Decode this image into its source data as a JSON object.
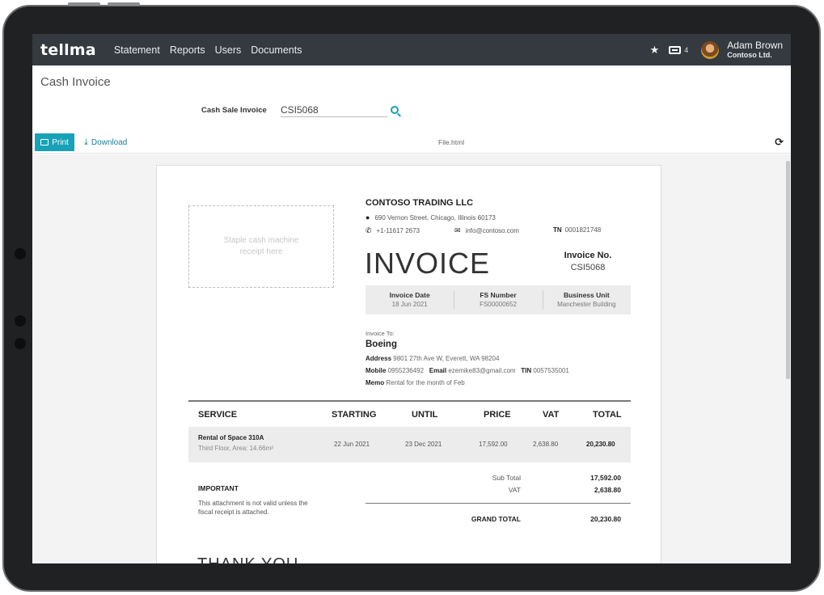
{
  "app": {
    "logo": "tellma",
    "nav": [
      "Statement",
      "Reports",
      "Users",
      "Documents"
    ],
    "inbox_count": "4",
    "user_name": "Adam Brown",
    "user_org": "Contoso Ltd."
  },
  "page": {
    "title": "Cash Invoice",
    "field_label": "Cash Sale Invoice",
    "field_value": "CSI5068"
  },
  "toolbar": {
    "print_label": "Print",
    "download_label": "Download",
    "file_name": "File.html"
  },
  "invoice": {
    "staple_note": "Staple cash machine receipt here",
    "company": "CONTOSO TRADING LLC",
    "address": "690 Vernon Street, Chicago, Illinois 60173",
    "phone": "+1-11617 2673",
    "email": "info@contoso.com",
    "tn_label": "TN",
    "tn_value": "0001821748",
    "title": "INVOICE",
    "invoice_no_label": "Invoice No.",
    "invoice_no_value": "CSI5068",
    "info": [
      {
        "label": "Invoice Date",
        "value": "18 Jun 2021"
      },
      {
        "label": "FS Number",
        "value": "FS00000652"
      },
      {
        "label": "Business Unit",
        "value": "Manchester Building"
      }
    ],
    "invoice_to_label": "Invoice To:",
    "client": "Boeing",
    "address_label": "Address",
    "client_address": "9801 27th Ave W, Everett, WA 98204",
    "mobile_label": "Mobile",
    "mobile": "0955236492",
    "email_label": "Email",
    "client_email": "ezemike83@gmail.com",
    "tin_label": "TIN",
    "tin": "0057535001",
    "memo_label": "Memo",
    "memo": "Rental for the month of Feb",
    "columns": [
      "SERVICE",
      "STARTING",
      "UNTIL",
      "PRICE",
      "VAT",
      "TOTAL"
    ],
    "item": {
      "name": "Rental of Space 310A",
      "desc": "Third Floor, Area: 14.66m²",
      "starting": "22 Jun 2021",
      "until": "23 Dec 2021",
      "price": "17,592.00",
      "vat": "2,638.80",
      "total": "20,230.80"
    },
    "important_title": "IMPORTANT",
    "important_text": "This attachment is not valid unless the fiscal receipt is attached.",
    "subtotal_label": "Sub Total",
    "subtotal": "17,592.00",
    "vat_label": "VAT",
    "vat": "2,638.80",
    "grand_total_label": "GRAND TOTAL",
    "grand_total": "20,230.80",
    "thank_you": "THANK YOU"
  },
  "colors": {
    "topbar": "#343a40",
    "accent": "#17a2b8"
  },
  "icons": [
    "star-icon",
    "inbox-icon",
    "search-icon",
    "print-icon",
    "download-icon",
    "refresh-icon",
    "map-marker-icon",
    "phone-icon",
    "envelope-icon"
  ]
}
